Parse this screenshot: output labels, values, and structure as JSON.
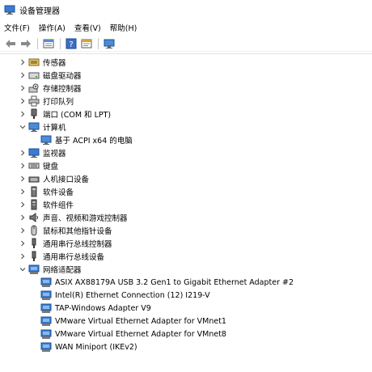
{
  "window": {
    "title": "设备管理器"
  },
  "menu": [
    {
      "label": "文件(F)"
    },
    {
      "label": "操作(A)"
    },
    {
      "label": "查看(V)"
    },
    {
      "label": "帮助(H)"
    }
  ],
  "toolbar": [
    {
      "icon": "back-arrow-icon"
    },
    {
      "icon": "forward-arrow-icon"
    },
    {
      "icon": "properties-icon"
    },
    {
      "icon": "help-icon"
    },
    {
      "icon": "update-driver-icon"
    },
    {
      "icon": "monitor-scan-icon"
    }
  ],
  "tree": [
    {
      "label": "传感器",
      "level": 0,
      "state": "collapsed",
      "icon": "sensor-icon"
    },
    {
      "label": "磁盘驱动器",
      "level": 0,
      "state": "collapsed",
      "icon": "disk-drive-icon"
    },
    {
      "label": "存储控制器",
      "level": 0,
      "state": "collapsed",
      "icon": "storage-controller-icon"
    },
    {
      "label": "打印队列",
      "level": 0,
      "state": "collapsed",
      "icon": "printer-icon"
    },
    {
      "label": "端口 (COM 和 LPT)",
      "level": 0,
      "state": "collapsed",
      "icon": "port-icon"
    },
    {
      "label": "计算机",
      "level": 0,
      "state": "expanded",
      "icon": "computer-icon"
    },
    {
      "label": "基于 ACPI x64 的电脑",
      "level": 1,
      "state": "leaf",
      "icon": "computer-icon"
    },
    {
      "label": "监视器",
      "level": 0,
      "state": "collapsed",
      "icon": "monitor-icon"
    },
    {
      "label": "键盘",
      "level": 0,
      "state": "collapsed",
      "icon": "keyboard-icon"
    },
    {
      "label": "人机接口设备",
      "level": 0,
      "state": "collapsed",
      "icon": "hid-icon"
    },
    {
      "label": "软件设备",
      "level": 0,
      "state": "collapsed",
      "icon": "software-device-icon"
    },
    {
      "label": "软件组件",
      "level": 0,
      "state": "collapsed",
      "icon": "software-component-icon"
    },
    {
      "label": "声音、视频和游戏控制器",
      "level": 0,
      "state": "collapsed",
      "icon": "speaker-icon"
    },
    {
      "label": "鼠标和其他指针设备",
      "level": 0,
      "state": "collapsed",
      "icon": "mouse-icon"
    },
    {
      "label": "通用串行总线控制器",
      "level": 0,
      "state": "collapsed",
      "icon": "usb-icon"
    },
    {
      "label": "通用串行总线设备",
      "level": 0,
      "state": "collapsed",
      "icon": "usb-icon"
    },
    {
      "label": "网络适配器",
      "level": 0,
      "state": "expanded",
      "icon": "network-adapter-icon"
    },
    {
      "label": "ASIX AX88179A USB 3.2 Gen1 to Gigabit Ethernet Adapter #2",
      "level": 1,
      "state": "leaf",
      "icon": "network-adapter-icon"
    },
    {
      "label": "Intel(R) Ethernet Connection (12) I219-V",
      "level": 1,
      "state": "leaf",
      "icon": "network-adapter-icon"
    },
    {
      "label": "TAP-Windows Adapter V9",
      "level": 1,
      "state": "leaf",
      "icon": "network-adapter-icon"
    },
    {
      "label": "VMware Virtual Ethernet Adapter for VMnet1",
      "level": 1,
      "state": "leaf",
      "icon": "network-adapter-icon"
    },
    {
      "label": "VMware Virtual Ethernet Adapter for VMnet8",
      "level": 1,
      "state": "leaf",
      "icon": "network-adapter-icon"
    },
    {
      "label": "WAN Miniport (IKEv2)",
      "level": 1,
      "state": "leaf",
      "icon": "network-adapter-icon"
    }
  ]
}
